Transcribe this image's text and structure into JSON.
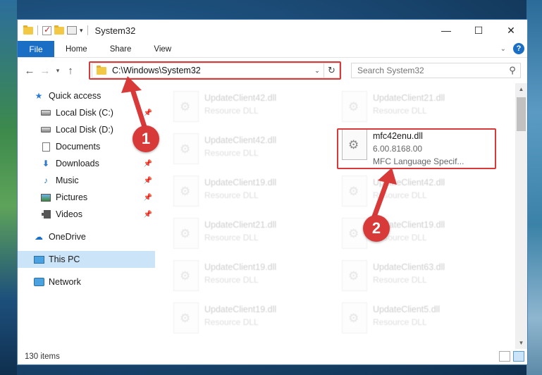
{
  "window": {
    "title": "System32",
    "controls": {
      "minimize": "—",
      "maximize": "☐",
      "close": "✕"
    }
  },
  "ribbon": {
    "file": "File",
    "tabs": [
      "Home",
      "Share",
      "View"
    ],
    "help": "?"
  },
  "address": {
    "path": "C:\\Windows\\System32"
  },
  "search": {
    "placeholder": "Search System32"
  },
  "sidebar": {
    "quick_access": "Quick access",
    "items": [
      {
        "label": "Local Disk (C:)",
        "icon": "drive-icon"
      },
      {
        "label": "Local Disk (D:)",
        "icon": "drive-icon"
      },
      {
        "label": "Documents",
        "icon": "document-icon"
      },
      {
        "label": "Downloads",
        "icon": "download-icon"
      },
      {
        "label": "Music",
        "icon": "music-icon"
      },
      {
        "label": "Pictures",
        "icon": "picture-icon"
      },
      {
        "label": "Videos",
        "icon": "video-icon"
      }
    ],
    "onedrive": "OneDrive",
    "this_pc": "This PC",
    "network": "Network"
  },
  "files": {
    "faded": [
      {
        "name": "UpdateClient42.dll",
        "sub": "Resource DLL"
      },
      {
        "name": "UpdateClient21.dll",
        "sub": "Resource DLL"
      },
      {
        "name": "UpdateClient42.dll",
        "sub": "Resource DLL"
      },
      {
        "name": "UpdateClient19.dll",
        "sub": "Resource DLL"
      },
      {
        "name": "UpdateClient42.dll",
        "sub": "Resource DLL"
      },
      {
        "name": "UpdateClient21.dll",
        "sub": "Resource DLL"
      },
      {
        "name": "UpdateClient19.dll",
        "sub": "Resource DLL"
      },
      {
        "name": "UpdateClient19.dll",
        "sub": "Resource DLL"
      },
      {
        "name": "UpdateClient63.dll",
        "sub": "Resource DLL"
      },
      {
        "name": "UpdateClient19.dll",
        "sub": "Resource DLL"
      },
      {
        "name": "UpdateClient5.dll",
        "sub": "Resource DLL"
      }
    ],
    "highlight": {
      "name": "mfc42enu.dll",
      "version": "6.00.8168.00",
      "description": "MFC Language Specif..."
    }
  },
  "status": {
    "item_count": "130 items"
  },
  "callouts": {
    "one": "1",
    "two": "2",
    "color": "#d83a3a"
  }
}
